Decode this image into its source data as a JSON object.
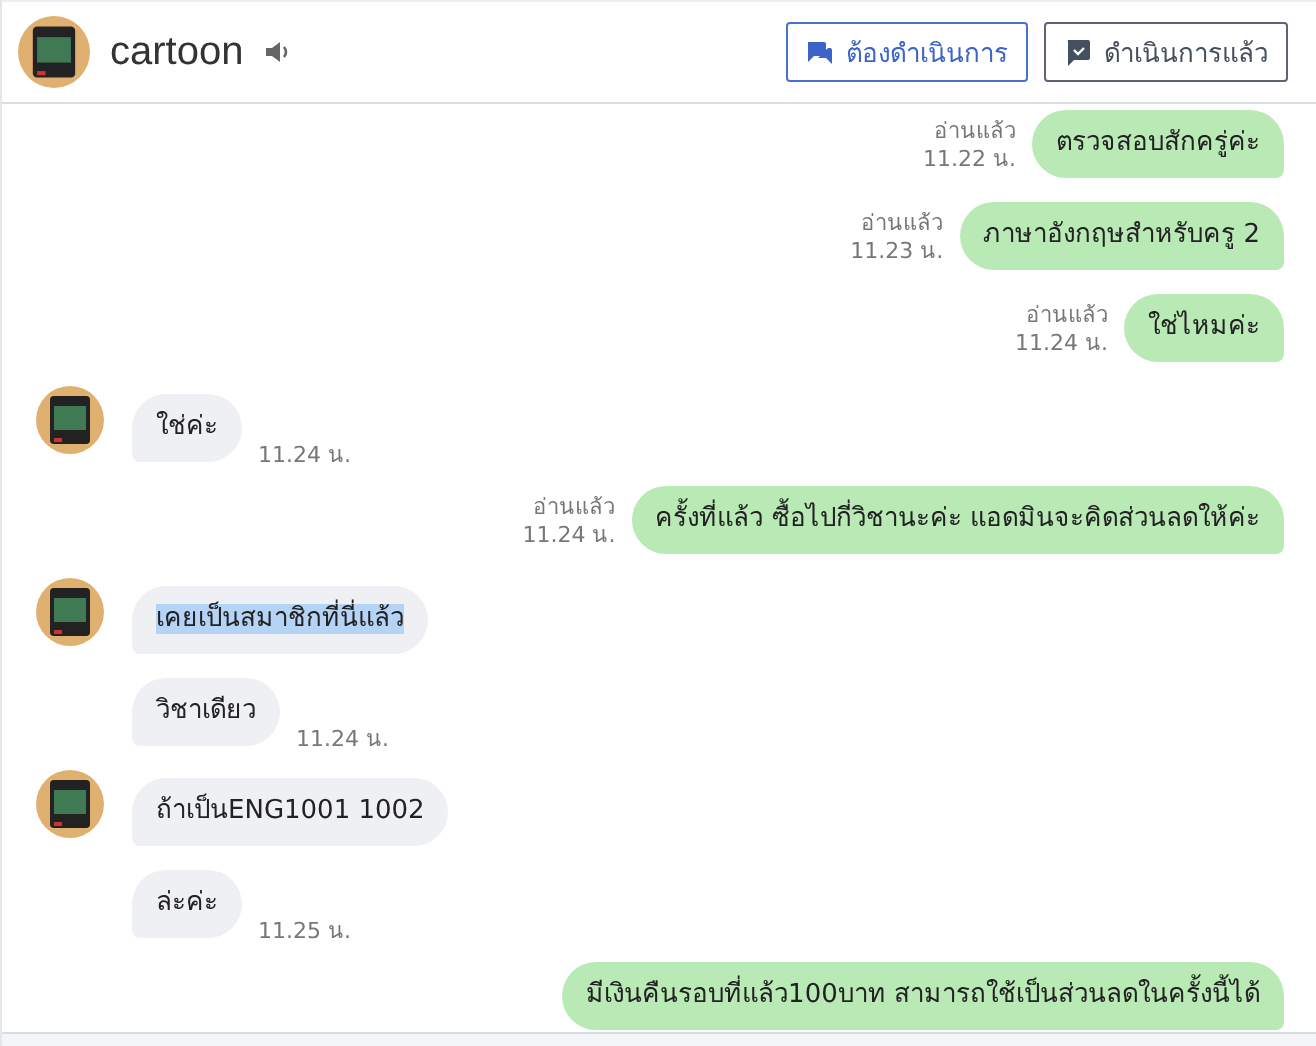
{
  "header": {
    "name": "cartoon",
    "buttons": [
      {
        "label": "ต้องดำเนินการ",
        "selected": true
      },
      {
        "label": "ดำเนินการแล้ว",
        "selected": false
      }
    ]
  },
  "messages": [
    {
      "kind": "out",
      "text": "ตรวจสอบสักครู่ค่ะ",
      "read": "อ่านแล้ว",
      "time": "11.22 น."
    },
    {
      "kind": "out",
      "text": "ภาษาอังกฤษสำหรับครู 2",
      "read": "อ่านแล้ว",
      "time": "11.23 น."
    },
    {
      "kind": "out",
      "text": "ใช่ไหมค่ะ",
      "read": "อ่านแล้ว",
      "time": "11.24 น."
    },
    {
      "kind": "in",
      "avatar": true,
      "text": "ใช่ค่ะ",
      "time": "11.24 น."
    },
    {
      "kind": "out",
      "text": "ครั้งที่แล้ว ซื้อไปกี่วิชานะค่ะ แอดมินจะคิดส่วนลดให้ค่ะ",
      "read": "อ่านแล้ว",
      "time": "11.24 น."
    },
    {
      "kind": "in",
      "avatar": true,
      "text": "เคยเป็นสมาชิกที่นี่แล้ว",
      "highlighted": true
    },
    {
      "kind": "in",
      "avatar": false,
      "text": "วิชาเดียว",
      "time": "11.24 น."
    },
    {
      "kind": "in",
      "avatar": true,
      "text": "ถ้าเป็นENG1001 1002"
    },
    {
      "kind": "in",
      "avatar": false,
      "text": "ล่ะค่ะ",
      "time": "11.25 น."
    },
    {
      "kind": "out",
      "text": "มีเงินคืนรอบที่แล้ว100บาท สามารถใช้เป็นส่วนลดในครั้งนี้ได้"
    }
  ]
}
